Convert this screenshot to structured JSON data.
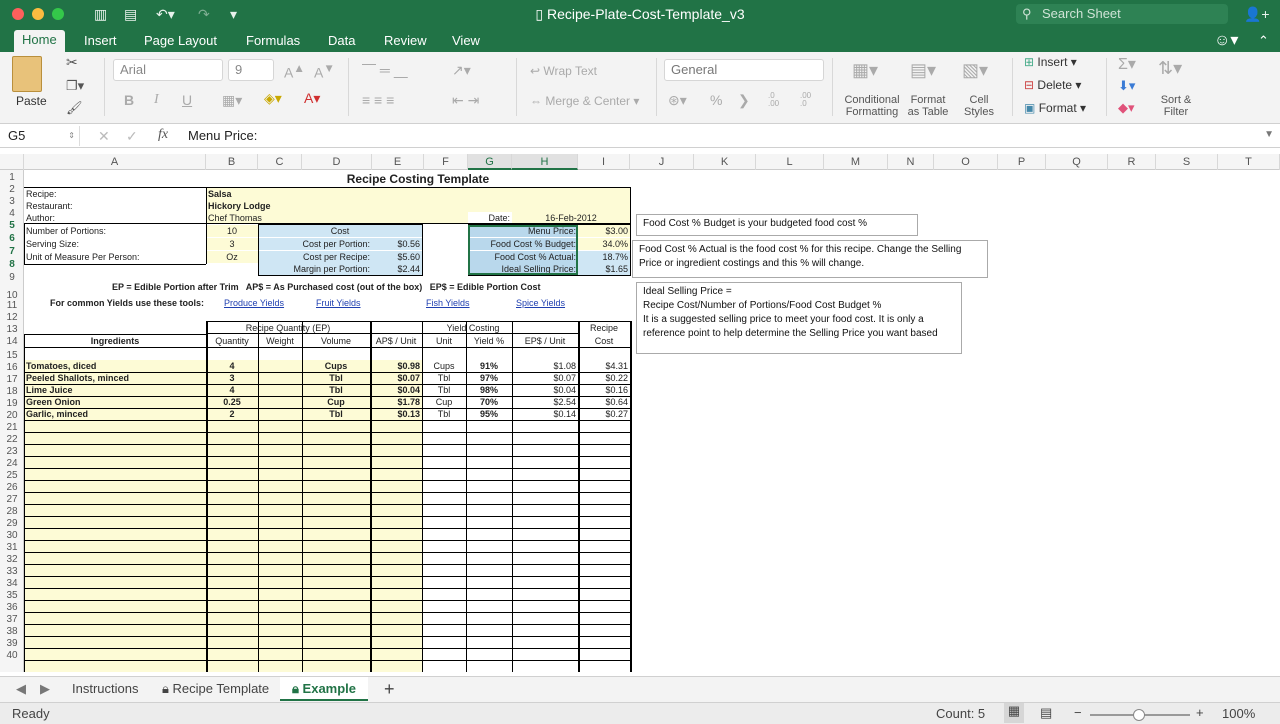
{
  "app": {
    "doc_title": "Recipe-Plate-Cost-Template_v3",
    "search_placeholder": "Search Sheet"
  },
  "tabs": [
    "Home",
    "Insert",
    "Page Layout",
    "Formulas",
    "Data",
    "Review",
    "View"
  ],
  "ribbon": {
    "paste": "Paste",
    "font": "Arial",
    "size": "9",
    "wrap_text": "Wrap Text",
    "merge_center": "Merge & Center",
    "number_format": "General",
    "conditional_formatting": [
      "Conditional",
      "Formatting"
    ],
    "format_as_table": [
      "Format",
      "as Table"
    ],
    "cell_styles": [
      "Cell",
      "Styles"
    ],
    "insert": "Insert",
    "delete": "Delete",
    "format": "Format",
    "sort_filter": [
      "Sort &",
      "Filter"
    ],
    "bold": "B",
    "italic": "I",
    "underline": "U",
    "percent": "%",
    "dec_inc": ".0\n.00",
    "dec_dec": ".00\n.0"
  },
  "formula_bar": {
    "cell_ref": "G5",
    "fx": "fx",
    "formula": "Menu Price:"
  },
  "columns": [
    "A",
    "B",
    "C",
    "D",
    "E",
    "F",
    "G",
    "H",
    "I",
    "J",
    "K",
    "L",
    "M",
    "N",
    "O",
    "P",
    "Q",
    "R",
    "S",
    "T"
  ],
  "rows": [
    "1",
    "2",
    "3",
    "4",
    "5",
    "6",
    "7",
    "8",
    "9",
    "10",
    "11",
    "12",
    "13",
    "14",
    "15",
    "16",
    "17",
    "18",
    "19",
    "20",
    "21",
    "22",
    "23",
    "24",
    "25",
    "26",
    "27",
    "28",
    "29",
    "30",
    "31",
    "32",
    "33",
    "34",
    "35",
    "36",
    "37",
    "38",
    "39",
    "40"
  ],
  "sheet": {
    "title": "Recipe Costing Template",
    "recipe_label": "Recipe:",
    "recipe": "Salsa",
    "restaurant_label": "Restaurant:",
    "restaurant": "Hickory Lodge",
    "author_label": "Author:",
    "author": "Chef Thomas",
    "date_label": "Date:",
    "date": "16-Feb-2012",
    "portions_label": "Number of Portions:",
    "portions": "10",
    "serving_label": "Serving Size:",
    "serving": "3",
    "uom_label": "Unit of Measure Per Person:",
    "uom": "Oz",
    "cost_header": "Cost",
    "cost_per_portion_label": "Cost per Portion:",
    "cost_per_portion": "$0.56",
    "cost_per_recipe_label": "Cost per Recipe:",
    "cost_per_recipe": "$5.60",
    "margin_label": "Margin per Portion:",
    "margin": "$2.44",
    "menu_price_label": "Menu Price:",
    "menu_price": "$3.00",
    "fc_budget_label": "Food Cost % Budget:",
    "fc_budget": "34.0%",
    "fc_actual_label": "Food Cost % Actual:",
    "fc_actual": "18.7%",
    "ideal_price_label": "Ideal Selling Price:",
    "ideal_price": "$1.65",
    "legend": "EP = Edible Portion after Trim   AP$ = As Purchased cost (out of the box)   EP$ = Edible Portion Cost",
    "tools_label": "For common Yields use these tools:",
    "links": [
      "Produce Yields",
      "Fruit Yields",
      "Fish Yields",
      "Spice Yields"
    ],
    "group_qty": "Recipe Quantity (EP)",
    "group_yield": "Yield Costing",
    "recipe_cost_top": "Recipe",
    "headers": [
      "Ingredients",
      "Quantity",
      "Weight",
      "Volume",
      "AP$ / Unit",
      "Unit",
      "Yield %",
      "EP$ / Unit",
      "Cost"
    ],
    "ingredients": [
      {
        "name": "Tomatoes, diced",
        "qty": "4",
        "weight": "",
        "volume": "Cups",
        "ap": "$0.98",
        "unit": "Cups",
        "yield": "91%",
        "ep": "$1.08",
        "cost": "$4.31"
      },
      {
        "name": "Peeled Shallots, minced",
        "qty": "3",
        "weight": "",
        "volume": "Tbl",
        "ap": "$0.07",
        "unit": "Tbl",
        "yield": "97%",
        "ep": "$0.07",
        "cost": "$0.22"
      },
      {
        "name": "Lime Juice",
        "qty": "4",
        "weight": "",
        "volume": "Tbl",
        "ap": "$0.04",
        "unit": "Tbl",
        "yield": "98%",
        "ep": "$0.04",
        "cost": "$0.16"
      },
      {
        "name": "Green Onion",
        "qty": "0.25",
        "weight": "",
        "volume": "Cup",
        "ap": "$1.78",
        "unit": "Cup",
        "yield": "70%",
        "ep": "$2.54",
        "cost": "$0.64"
      },
      {
        "name": "Garlic, minced",
        "qty": "2",
        "weight": "",
        "volume": "Tbl",
        "ap": "$0.13",
        "unit": "Tbl",
        "yield": "95%",
        "ep": "$0.14",
        "cost": "$0.27"
      }
    ]
  },
  "notes": {
    "n1": "Food Cost % Budget is your budgeted food cost %",
    "n2": "Food Cost % Actual is the food cost % for this recipe.  Change the Selling Price or ingredient costings and this % will change.",
    "n3a": "Ideal Selling Price =",
    "n3b": "Recipe Cost/Number of Portions/Food Cost Budget %",
    "n3c": "It is a suggested selling price to meet your food cost.  It is only a reference point to help determine the Selling Price you want based"
  },
  "sheet_tabs": [
    "Instructions",
    "Recipe Template",
    "Example"
  ],
  "status": {
    "ready": "Ready",
    "count": "Count: 5",
    "zoom": "100%"
  },
  "colors": {
    "accent": "#217346",
    "input_fill": "#fdfbd6",
    "calc_fill": "#cfe6f4"
  }
}
